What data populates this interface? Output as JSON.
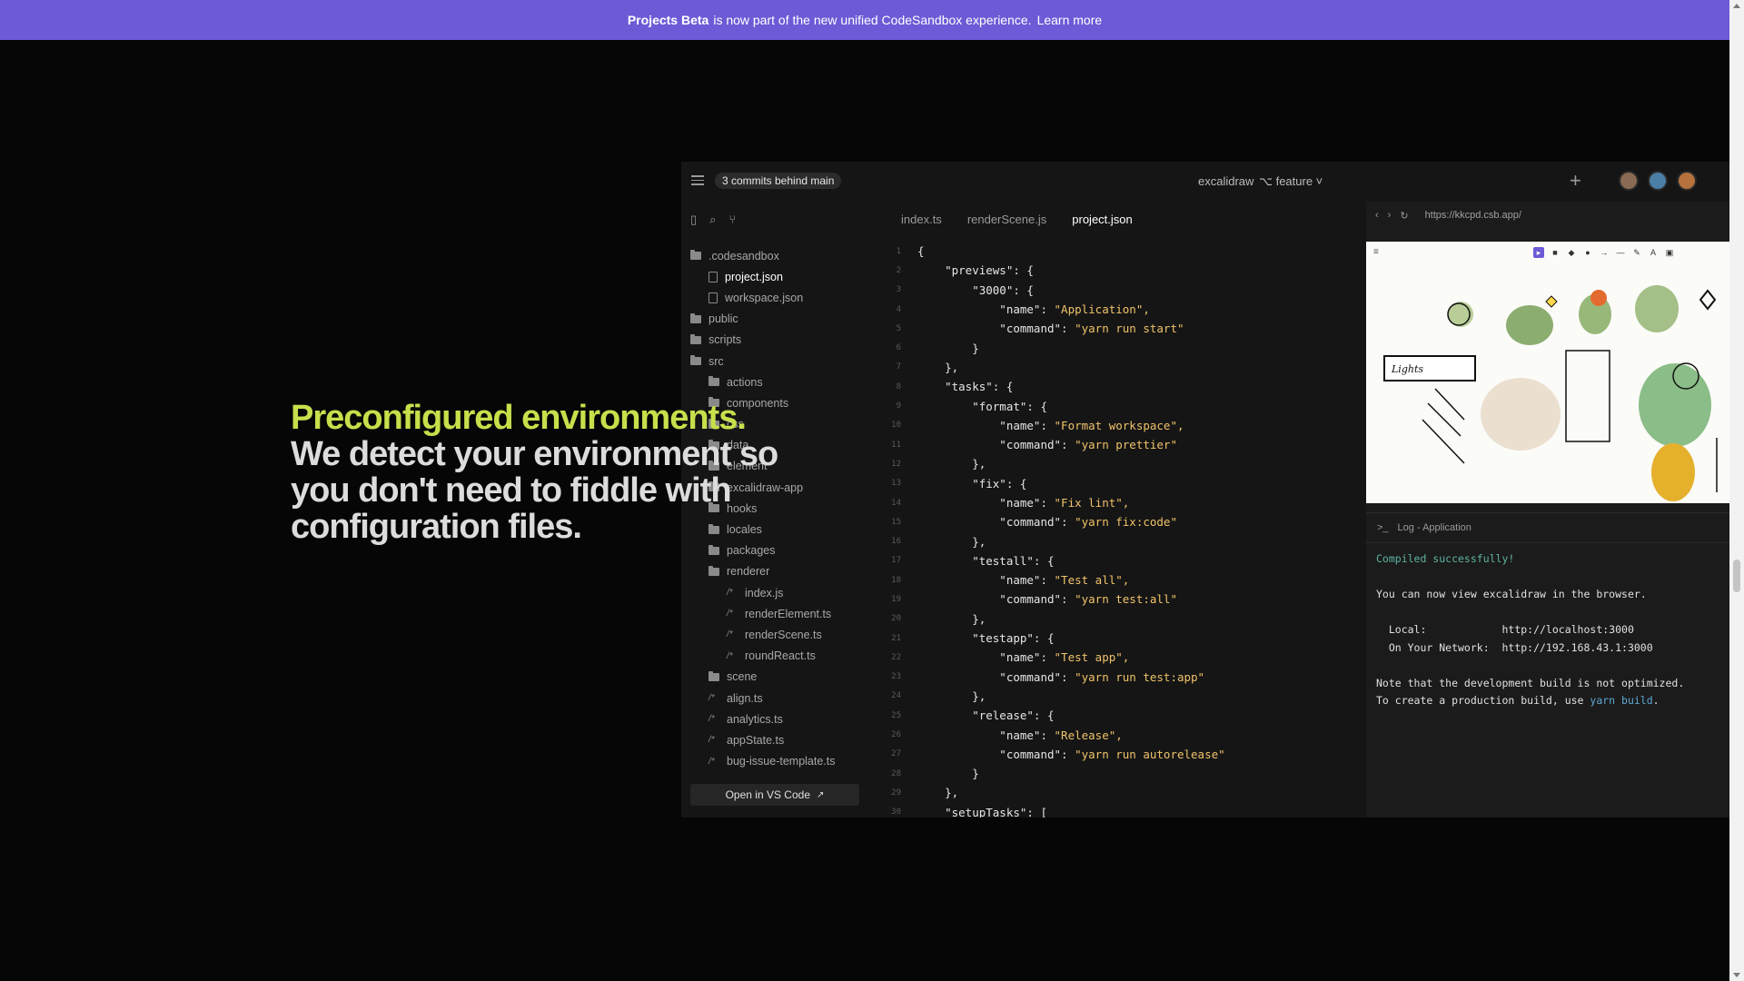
{
  "banner": {
    "bold": "Projects Beta",
    "text": "is now part of the new unified CodeSandbox experience.",
    "link": "Learn more"
  },
  "hero": {
    "headline": "Preconfigured environments.",
    "body": "We detect your environment so you don't need to fiddle with configuration files."
  },
  "ide": {
    "commits_badge": "3 commits behind main",
    "repo": "excalidraw",
    "branch": "⌥ feature ˅",
    "tabs": [
      "index.ts",
      "renderScene.js",
      "project.json"
    ],
    "active_tab": "project.json",
    "tree": [
      {
        "label": ".codesandbox",
        "type": "folder-open",
        "depth": 0
      },
      {
        "label": "project.json",
        "type": "file",
        "depth": 1,
        "active": true
      },
      {
        "label": "workspace.json",
        "type": "file",
        "depth": 1
      },
      {
        "label": "public",
        "type": "folder",
        "depth": 0
      },
      {
        "label": "scripts",
        "type": "folder",
        "depth": 0
      },
      {
        "label": "src",
        "type": "folder-open",
        "depth": 0
      },
      {
        "label": "actions",
        "type": "folder",
        "depth": 1
      },
      {
        "label": "components",
        "type": "folder",
        "depth": 1
      },
      {
        "label": "css",
        "type": "folder",
        "depth": 1
      },
      {
        "label": "data",
        "type": "folder",
        "depth": 1
      },
      {
        "label": "element",
        "type": "folder",
        "depth": 1
      },
      {
        "label": "excalidraw-app",
        "type": "folder",
        "depth": 1
      },
      {
        "label": "hooks",
        "type": "folder",
        "depth": 1
      },
      {
        "label": "locales",
        "type": "folder",
        "depth": 1
      },
      {
        "label": "packages",
        "type": "folder",
        "depth": 1
      },
      {
        "label": "renderer",
        "type": "folder-open",
        "depth": 1
      },
      {
        "label": "index.js",
        "type": "ts",
        "depth": 2
      },
      {
        "label": "renderElement.ts",
        "type": "ts",
        "depth": 2
      },
      {
        "label": "renderScene.ts",
        "type": "ts",
        "depth": 2
      },
      {
        "label": "roundReact.ts",
        "type": "ts",
        "depth": 2
      },
      {
        "label": "scene",
        "type": "folder",
        "depth": 1
      },
      {
        "label": "align.ts",
        "type": "ts",
        "depth": 1
      },
      {
        "label": "analytics.ts",
        "type": "ts",
        "depth": 1
      },
      {
        "label": "appState.ts",
        "type": "ts",
        "depth": 1
      },
      {
        "label": "bug-issue-template.ts",
        "type": "ts",
        "depth": 1
      }
    ],
    "open_vscode": "Open in VS Code",
    "code": [
      [
        1,
        "{",
        ""
      ],
      [
        2,
        "    \"previews\": {",
        ""
      ],
      [
        3,
        "        \"3000\": {",
        ""
      ],
      [
        4,
        "            \"name\": ",
        "\"Application\","
      ],
      [
        5,
        "            \"command\": ",
        "\"yarn run start\""
      ],
      [
        6,
        "        }",
        ""
      ],
      [
        7,
        "    },",
        ""
      ],
      [
        8,
        "    \"tasks\": {",
        ""
      ],
      [
        9,
        "        \"format\": {",
        ""
      ],
      [
        10,
        "            \"name\": ",
        "\"Format workspace\","
      ],
      [
        11,
        "            \"command\": ",
        "\"yarn prettier\""
      ],
      [
        12,
        "        },",
        ""
      ],
      [
        13,
        "        \"fix\": {",
        ""
      ],
      [
        14,
        "            \"name\": ",
        "\"Fix lint\","
      ],
      [
        15,
        "            \"command\": ",
        "\"yarn fix:code\""
      ],
      [
        16,
        "        },",
        ""
      ],
      [
        17,
        "        \"testall\": {",
        ""
      ],
      [
        18,
        "            \"name\": ",
        "\"Test all\","
      ],
      [
        19,
        "            \"command\": ",
        "\"yarn test:all\""
      ],
      [
        20,
        "        },",
        ""
      ],
      [
        21,
        "        \"testapp\": {",
        ""
      ],
      [
        22,
        "            \"name\": ",
        "\"Test app\","
      ],
      [
        23,
        "            \"command\": ",
        "\"yarn run test:app\""
      ],
      [
        24,
        "        },",
        ""
      ],
      [
        25,
        "        \"release\": {",
        ""
      ],
      [
        26,
        "            \"name\": ",
        "\"Release\","
      ],
      [
        27,
        "            \"command\": ",
        "\"yarn run autorelease\""
      ],
      [
        28,
        "        }",
        ""
      ],
      [
        29,
        "    },",
        ""
      ],
      [
        30,
        "    \"setupTasks\": [",
        ""
      ]
    ],
    "preview_url": "https://kkcpd.csb.app/",
    "canvas_label": "Lights",
    "log_title": "Log - Application",
    "log": {
      "compiled": "Compiled successfully!",
      "view": "You can now view excalidraw in the browser.",
      "local": "  Local:            http://localhost:3000",
      "network": "  On Your Network:  http://192.168.43.1:3000",
      "note": "Note that the development build is not optimized.",
      "prod_prefix": "To create a production build, use ",
      "prod_cmd": "yarn build",
      "prod_suffix": "."
    }
  }
}
